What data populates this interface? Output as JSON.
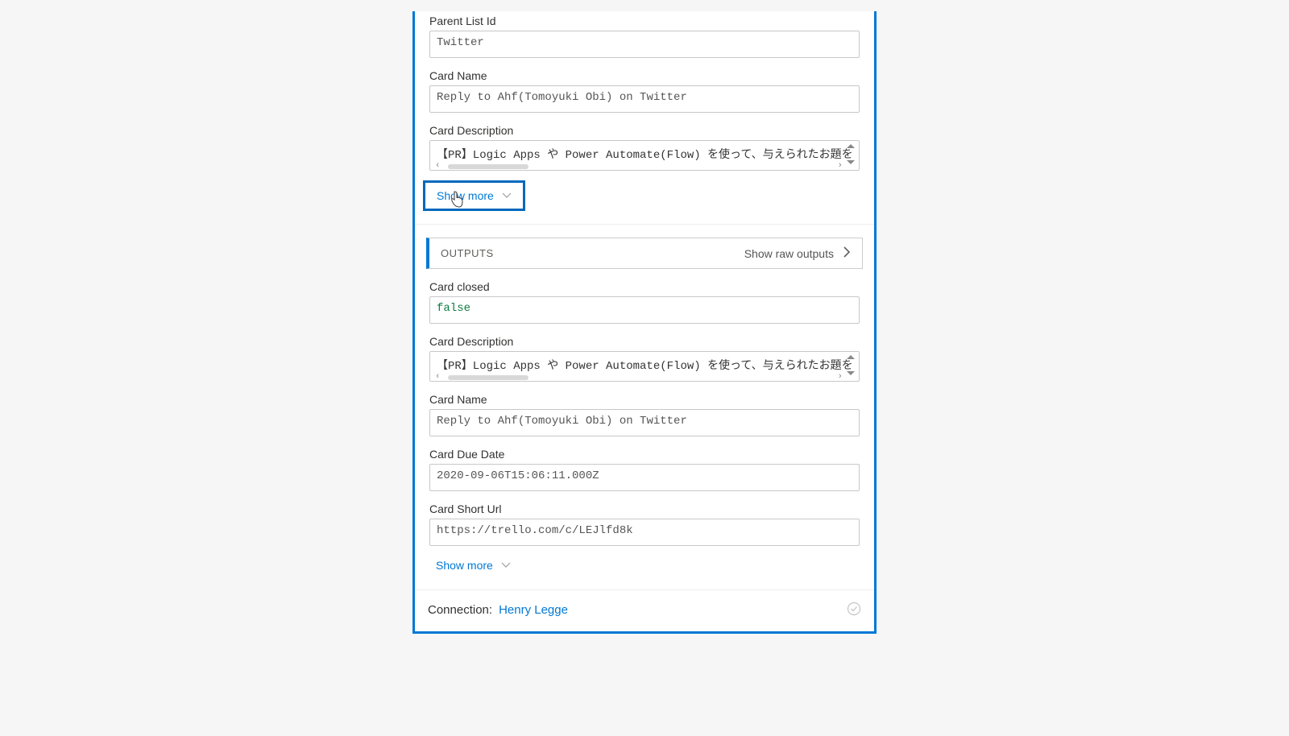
{
  "inputs": {
    "fields": [
      {
        "label": "Parent List Id",
        "value": "Twitter",
        "multiline": false,
        "key": "parent_list_id"
      },
      {
        "label": "Card Name",
        "value": "Reply to Ahf(Tomoyuki Obi) on Twitter",
        "multiline": false,
        "key": "card_name"
      },
      {
        "label": "Card Description",
        "value": "【PR】Logic Apps や Power Automate(Flow) を使って、与えられたお題を",
        "multiline": true,
        "key": "card_description"
      }
    ],
    "show_more_label": "Show more"
  },
  "outputs": {
    "header_label": "OUTPUTS",
    "raw_link_label": "Show raw outputs",
    "fields": [
      {
        "label": "Card closed",
        "value": "false",
        "multiline": false,
        "boolean": true,
        "key": "card_closed"
      },
      {
        "label": "Card Description",
        "value": "【PR】Logic Apps や Power Automate(Flow) を使って、与えられたお題を",
        "multiline": true,
        "key": "card_description_out"
      },
      {
        "label": "Card Name",
        "value": "Reply to Ahf(Tomoyuki Obi) on Twitter",
        "multiline": false,
        "key": "card_name_out"
      },
      {
        "label": "Card Due Date",
        "value": "2020-09-06T15:06:11.000Z",
        "multiline": false,
        "key": "card_due_date"
      },
      {
        "label": "Card Short Url",
        "value": "https://trello.com/c/LEJlfd8k",
        "multiline": false,
        "key": "card_short_url"
      }
    ],
    "show_more_label": "Show more"
  },
  "connection": {
    "label": "Connection:",
    "name": "Henry Legge"
  },
  "highlight": {
    "show_more_inputs_boxed": true
  }
}
